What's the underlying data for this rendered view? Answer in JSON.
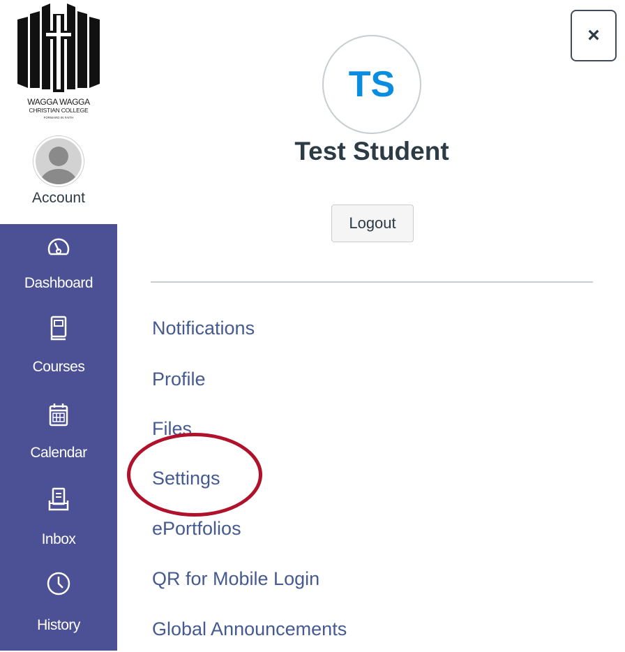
{
  "logo": {
    "line1": "WAGGA WAGGA",
    "line2": "CHRISTIAN COLLEGE",
    "line3": "FORWARD IN FAITH"
  },
  "global_nav": {
    "account_label": "Account",
    "items": [
      {
        "label": "Dashboard",
        "icon": "dashboard-icon"
      },
      {
        "label": "Courses",
        "icon": "courses-icon"
      },
      {
        "label": "Calendar",
        "icon": "calendar-icon"
      },
      {
        "label": "Inbox",
        "icon": "inbox-icon"
      },
      {
        "label": "History",
        "icon": "clock-icon"
      }
    ]
  },
  "tray": {
    "close_label": "×",
    "initials": "TS",
    "user_name": "Test Student",
    "logout_label": "Logout",
    "links": [
      "Notifications",
      "Profile",
      "Files",
      "Settings",
      "ePortfolios",
      "QR for Mobile Login",
      "Global Announcements"
    ]
  },
  "colors": {
    "nav_bg": "#4b5194",
    "link": "#465a92",
    "initials": "#0a8de0",
    "highlight": "#b0122b"
  }
}
